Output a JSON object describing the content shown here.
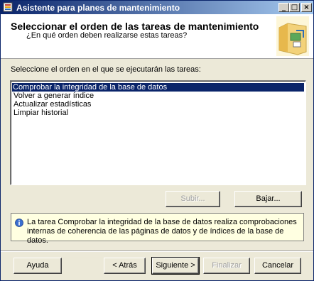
{
  "window": {
    "title": "Asistente para planes de mantenimiento",
    "minimize_glyph": "_",
    "maximize_glyph": "□",
    "close_glyph": "×"
  },
  "header": {
    "title": "Seleccionar el orden de las tareas de mantenimiento",
    "subtitle": "¿En qué orden deben realizarse estas tareas?"
  },
  "instruction": "Seleccione el orden en el que se ejecutarán las tareas:",
  "tasks": [
    "Comprobar la integridad de la base de datos",
    "Volver a generar índice",
    "Actualizar estadísticas",
    "Limpiar historial"
  ],
  "selected_index": 0,
  "move_buttons": {
    "up": "Subir...",
    "down": "Bajar..."
  },
  "info": "La tarea Comprobar la integridad de la base de datos realiza comprobaciones internas de coherencia de las páginas de datos y de índices de la base de datos.",
  "footer": {
    "help": "Ayuda",
    "back": "< Atrás",
    "next": "Siguiente >",
    "finish": "Finalizar",
    "cancel": "Cancelar"
  },
  "icons": {
    "app": "maintenance-plan-icon",
    "header": "wizard-folder-icon",
    "info": "info-icon"
  },
  "colors": {
    "titlebar_start": "#0a246a",
    "titlebar_end": "#a6caf0",
    "selection": "#0a246a",
    "info_background": "#ffffe1"
  }
}
